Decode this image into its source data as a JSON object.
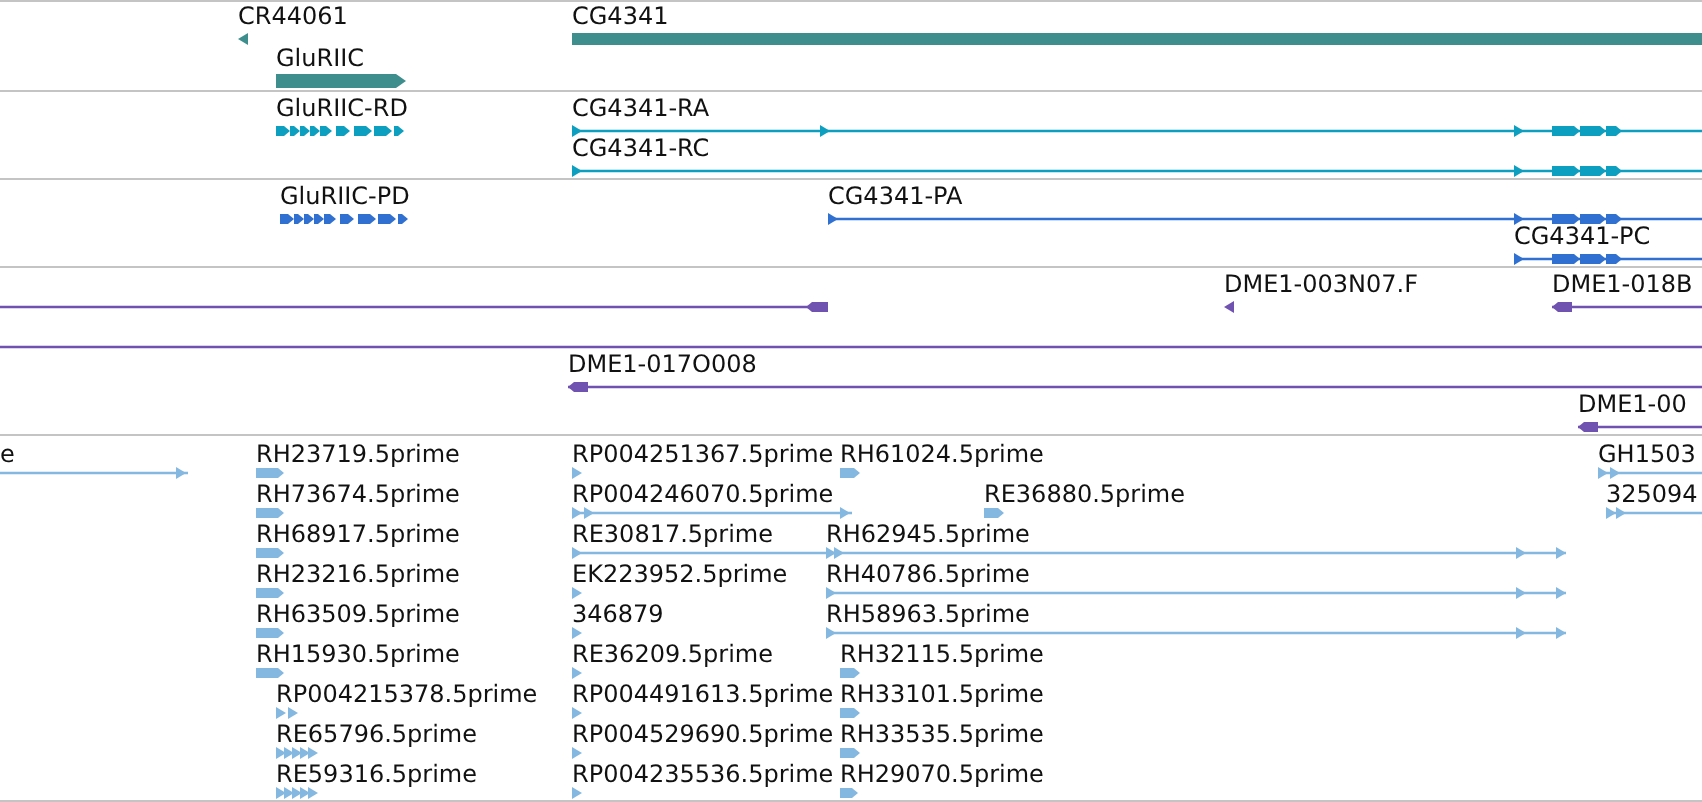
{
  "tracks": [
    {
      "kind": "genes",
      "features": [
        {
          "label": "CR44061"
        },
        {
          "label": "CG4341"
        },
        {
          "label": "GluRIIC"
        }
      ]
    },
    {
      "kind": "transcripts",
      "features": [
        {
          "label": "GluRIIC-RD"
        },
        {
          "label": "CG4341-RA"
        },
        {
          "label": "CG4341-RC"
        }
      ]
    },
    {
      "kind": "proteins",
      "features": [
        {
          "label": "GluRIIC-PD"
        },
        {
          "label": "CG4341-PA"
        },
        {
          "label": "CG4341-PC"
        }
      ]
    },
    {
      "kind": "clones",
      "features": [
        {
          "label": "DME1-003N07.F"
        },
        {
          "label": "DME1-018B"
        },
        {
          "label": "DME1-017O008"
        },
        {
          "label": "DME1-00"
        }
      ]
    },
    {
      "kind": "reads",
      "features": [
        {
          "label": "e"
        },
        {
          "label": "RH23719.5prime"
        },
        {
          "label": "RP004251367.5prime"
        },
        {
          "label": "RH61024.5prime"
        },
        {
          "label": "GH1503"
        },
        {
          "label": "RH73674.5prime"
        },
        {
          "label": "RP004246070.5prime"
        },
        {
          "label": "RE36880.5prime"
        },
        {
          "label": "325094"
        },
        {
          "label": "RH68917.5prime"
        },
        {
          "label": "RE30817.5prime"
        },
        {
          "label": "RH62945.5prime"
        },
        {
          "label": "RH23216.5prime"
        },
        {
          "label": "EK223952.5prime"
        },
        {
          "label": "RH40786.5prime"
        },
        {
          "label": "RH63509.5prime"
        },
        {
          "label": "346879"
        },
        {
          "label": "RH58963.5prime"
        },
        {
          "label": "RH15930.5prime"
        },
        {
          "label": "RE36209.5prime"
        },
        {
          "label": "RH32115.5prime"
        },
        {
          "label": "RP004215378.5prime"
        },
        {
          "label": "RP004491613.5prime"
        },
        {
          "label": "RH33101.5prime"
        },
        {
          "label": "RE65796.5prime"
        },
        {
          "label": "RP004529690.5prime"
        },
        {
          "label": "RH33535.5prime"
        },
        {
          "label": "RE59316.5prime"
        },
        {
          "label": "RP004235536.5prime"
        },
        {
          "label": "RH29070.5prime"
        }
      ]
    }
  ]
}
